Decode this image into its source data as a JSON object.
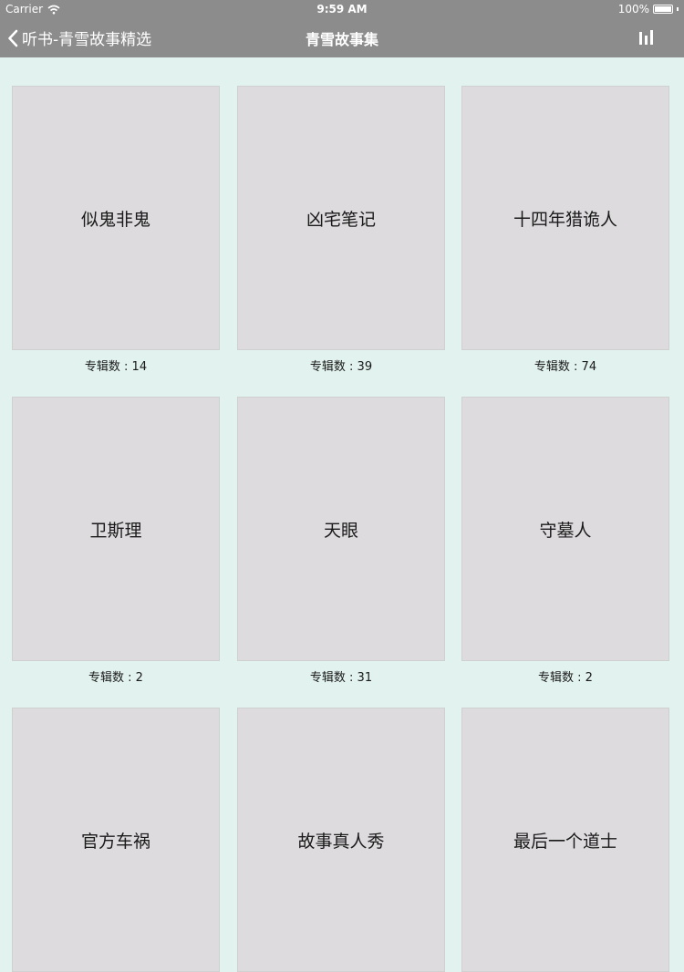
{
  "status_bar": {
    "carrier": "Carrier",
    "time": "9:59 AM",
    "battery": "100%",
    "battery_level": 1.0
  },
  "nav": {
    "back_label": "听书-青雪故事精选",
    "title": "青雪故事集",
    "right_icon": "bar-chart-icon"
  },
  "count_prefix": "专辑数 : ",
  "items": [
    {
      "title": "似鬼非鬼",
      "count": "专辑数 : 14"
    },
    {
      "title": "凶宅笔记",
      "count": "专辑数 : 39"
    },
    {
      "title": "十四年猎诡人",
      "count": "专辑数 : 74"
    },
    {
      "title": "卫斯理",
      "count": "专辑数 : 2"
    },
    {
      "title": "天眼",
      "count": "专辑数 : 31"
    },
    {
      "title": "守墓人",
      "count": "专辑数 : 2"
    },
    {
      "title": "官方车祸",
      "count": ""
    },
    {
      "title": "故事真人秀",
      "count": ""
    },
    {
      "title": "最后一个道士",
      "count": ""
    }
  ],
  "colors": {
    "bar": "#8c8c8c",
    "background": "#e2f2ee",
    "cover": "#dddbdd"
  }
}
